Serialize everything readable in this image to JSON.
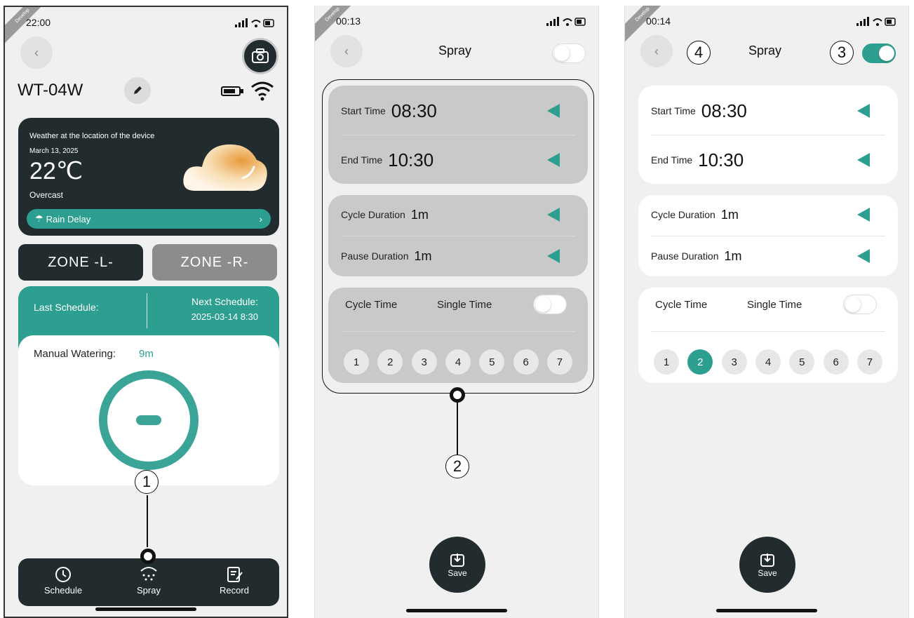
{
  "phone1": {
    "status": {
      "time": "22:00",
      "ribbon": "Develop"
    },
    "device_name": "WT-04W",
    "weather": {
      "title": "Weather at the location of the device",
      "date": "March 13, 2025",
      "temperature": "22℃",
      "condition": "Overcast",
      "rain_delay_label": "Rain Delay"
    },
    "zones": [
      "ZONE -L-",
      "ZONE -R-"
    ],
    "schedule": {
      "last_label": "Last Schedule:",
      "next_label": "Next Schedule:",
      "next_value": "2025-03-14 8:30"
    },
    "manual": {
      "label": "Manual Watering:",
      "value": "9m"
    },
    "tabs": [
      "Schedule",
      "Spray",
      "Record"
    ],
    "callout": "1"
  },
  "phone2": {
    "status": {
      "time": "00:13",
      "ribbon": "Develop"
    },
    "title": "Spray",
    "toggle_on": false,
    "start_time": {
      "label": "Start Time",
      "value": "08:30"
    },
    "end_time": {
      "label": "End Time",
      "value": "10:30"
    },
    "cycle_duration": {
      "label": "Cycle Duration",
      "value": "1m"
    },
    "pause_duration": {
      "label": "Pause Duration",
      "value": "1m"
    },
    "mode": {
      "cycle": "Cycle Time",
      "single": "Single Time"
    },
    "days": [
      "1",
      "2",
      "3",
      "4",
      "5",
      "6",
      "7"
    ],
    "save_label": "Save",
    "callout": "2"
  },
  "phone3": {
    "status": {
      "time": "00:14",
      "ribbon": "Develop"
    },
    "title": "Spray",
    "toggle_on": true,
    "start_time": {
      "label": "Start Time",
      "value": "08:30"
    },
    "end_time": {
      "label": "End Time",
      "value": "10:30"
    },
    "cycle_duration": {
      "label": "Cycle Duration",
      "value": "1m"
    },
    "pause_duration": {
      "label": "Pause Duration",
      "value": "1m"
    },
    "mode": {
      "cycle": "Cycle Time",
      "single": "Single Time"
    },
    "days": [
      "1",
      "2",
      "3",
      "4",
      "5",
      "6",
      "7"
    ],
    "active_day": "2",
    "save_label": "Save",
    "callout_back": "4",
    "callout_toggle": "3"
  },
  "colors": {
    "accent": "#2d9f90",
    "dark": "#222b2e",
    "zone_inactive": "#8c8c8c"
  }
}
